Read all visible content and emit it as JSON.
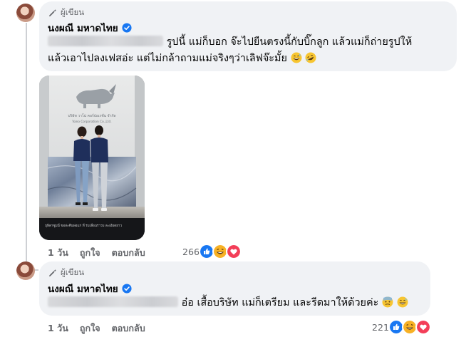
{
  "comments": [
    {
      "author_badge": "ผู้เขียน",
      "author_name": "นงผณี มหาดไทย",
      "line1_text": "รูปนี้ แม่ก็บอก จ๊ะไปยืนตรงนี้กับบิ๊กลูก แล้วแม่ก็ถ่ายรูปให้",
      "line2_text": "แล้วเอาไปลงเฟสอ่ะ แต่ไม่กล้าถามแม่จริงๆว่าเลิฟจ๊ะมั้ย",
      "time": "1 วัน",
      "like_label": "ถูกใจ",
      "reply_label": "ตอบกลับ",
      "reaction_count": "266",
      "reactions": [
        "like-icon",
        "haha-icon",
        "love-icon"
      ],
      "emojis": [
        "grinning-sweat-emoji",
        "rofl-emoji"
      ],
      "attached_photo": {
        "sign_text": "บริษัท วาโน่ คอร์ปอเรชั่น จำกัด",
        "sign_text_en": "Vano Corporation Co.,Ltd.",
        "caption": "บุพิดาซูมนี่ ขอล่ะคืนพ่อแก่ ที่ รมเลื่อนราวบ ละเอียดยาว"
      }
    },
    {
      "author_badge": "ผู้เขียน",
      "author_name": "นงผณี มหาดไทย",
      "line1_text": "อ๋อ เสื้อบริษัท แม่ก็เตรียม และรีดมาให้ด้วยค่ะ",
      "time": "1 วัน",
      "like_label": "ถูกใจ",
      "reply_label": "ตอบกลับ",
      "reaction_count": "221",
      "reactions": [
        "like-icon",
        "haha-icon",
        "love-icon"
      ],
      "emojis": [
        "cold-sweat-emoji",
        "grinning-sweat-emoji"
      ]
    }
  ],
  "colors": {
    "bubble": "#f0f2f5",
    "verified": "#1877f2",
    "like": "#1877f2",
    "love": "#f33e58",
    "haha": "#f7b125",
    "muted": "#65676b"
  }
}
